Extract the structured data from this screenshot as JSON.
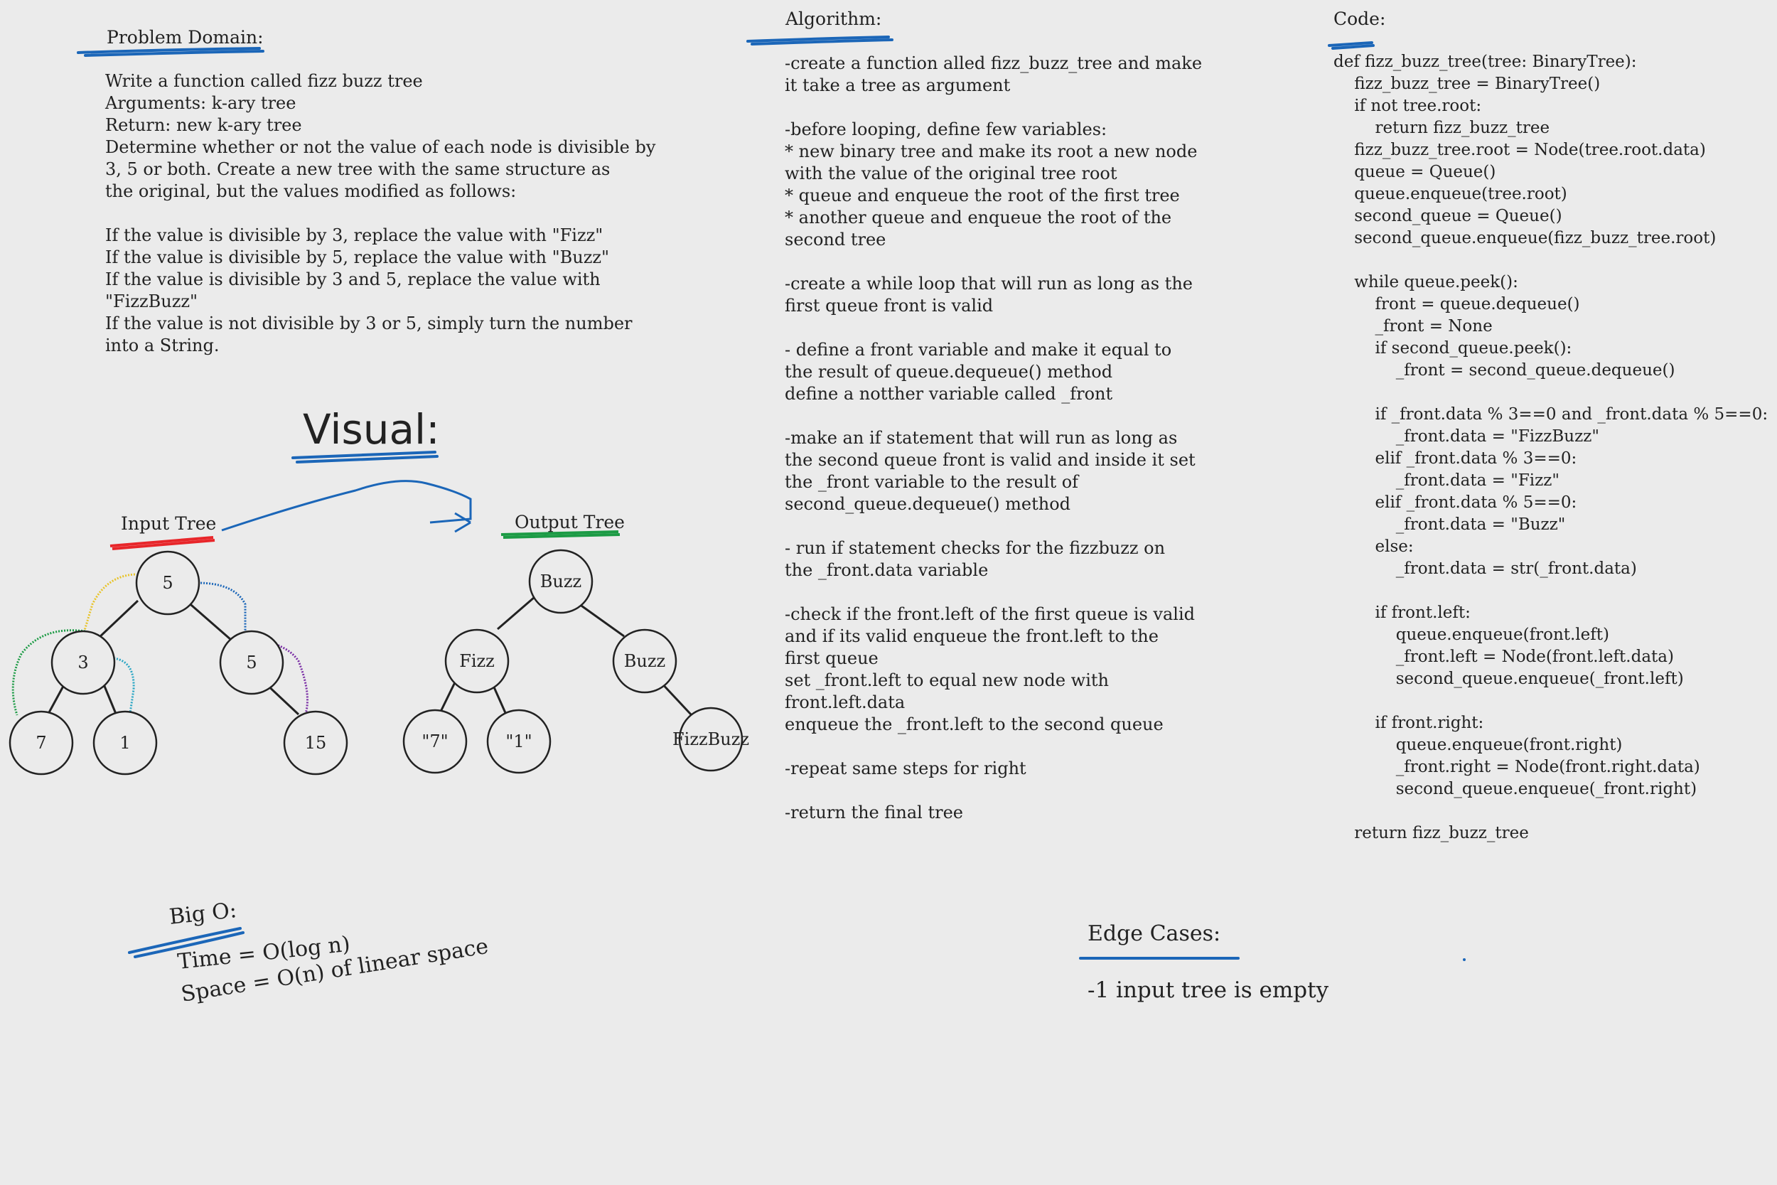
{
  "problem_domain": {
    "heading": "Problem Domain:",
    "body": "Write a function called fizz buzz tree\nArguments: k-ary tree\nReturn: new k-ary tree\nDetermine whether or not the value of each node is divisible by\n3, 5 or both. Create a new tree with the same structure as\nthe original, but the values modified as follows:\n\nIf the value is divisible by 3, replace the value with \"Fizz\"\nIf the value is divisible by 5, replace the value with \"Buzz\"\nIf the value is divisible by 3 and 5, replace the value with\n\"FizzBuzz\"\nIf the value is not divisible by 3 or 5, simply turn the number\ninto a String."
  },
  "visual": {
    "heading": "Visual:",
    "input_label": "Input Tree",
    "output_label": "Output Tree",
    "input_nodes": [
      "5",
      "3",
      "5",
      "7",
      "1",
      "15"
    ],
    "output_nodes": [
      "Buzz",
      "Fizz",
      "Buzz",
      "\"7\"",
      "\"1\"",
      "FizzBuzz"
    ],
    "colors": {
      "red": "#e8262a",
      "green": "#1c9b45",
      "blue": "#1b66b8",
      "yellow": "#e8c42a",
      "purple": "#7b2fa6",
      "teal": "#2aa6c4"
    }
  },
  "algorithm": {
    "heading": "Algorithm:",
    "body": "-create a function alled fizz_buzz_tree and make\nit take a tree as argument\n\n-before looping, define few variables:\n* new binary tree and make its root a new node\nwith the value of the original tree root\n* queue and enqueue the root of the first tree\n* another queue and enqueue the root of the\nsecond tree\n\n-create a while loop that will run as long as the\nfirst queue front is valid\n\n- define a front variable and make it equal to\nthe result of queue.dequeue() method\ndefine a notther variable called _front\n\n-make an if statement that will run as long as\nthe second queue front is valid and inside it set\nthe _front variable to the result of\nsecond_queue.dequeue() method\n\n- run if statement checks for the fizzbuzz on\nthe _front.data variable\n\n-check if the front.left of the first queue is valid\nand if its valid enqueue the front.left to the\nfirst queue\nset _front.left to equal new node with\nfront.left.data\nenqueue the _front.left to the second queue\n\n-repeat same steps for right\n\n-return the final tree"
  },
  "code": {
    "heading": "Code:",
    "body": "def fizz_buzz_tree(tree: BinaryTree):\n    fizz_buzz_tree = BinaryTree()\n    if not tree.root:\n        return fizz_buzz_tree\n    fizz_buzz_tree.root = Node(tree.root.data)\n    queue = Queue()\n    queue.enqueue(tree.root)\n    second_queue = Queue()\n    second_queue.enqueue(fizz_buzz_tree.root)\n\n    while queue.peek():\n        front = queue.dequeue()\n        _front = None\n        if second_queue.peek():\n            _front = second_queue.dequeue()\n\n        if _front.data % 3==0 and _front.data % 5==0:\n            _front.data = \"FizzBuzz\"\n        elif _front.data % 3==0:\n            _front.data = \"Fizz\"\n        elif _front.data % 5==0:\n            _front.data = \"Buzz\"\n        else:\n            _front.data = str(_front.data)\n\n        if front.left:\n            queue.enqueue(front.left)\n            _front.left = Node(front.left.data)\n            second_queue.enqueue(_front.left)\n\n        if front.right:\n            queue.enqueue(front.right)\n            _front.right = Node(front.right.data)\n            second_queue.enqueue(_front.right)\n\n    return fizz_buzz_tree"
  },
  "big_o": {
    "heading": "Big O:",
    "time": "Time = O(log n)",
    "space": "Space = O(n) of linear space"
  },
  "edge_cases": {
    "heading": "Edge Cases:",
    "item": "-1 input tree is empty"
  }
}
